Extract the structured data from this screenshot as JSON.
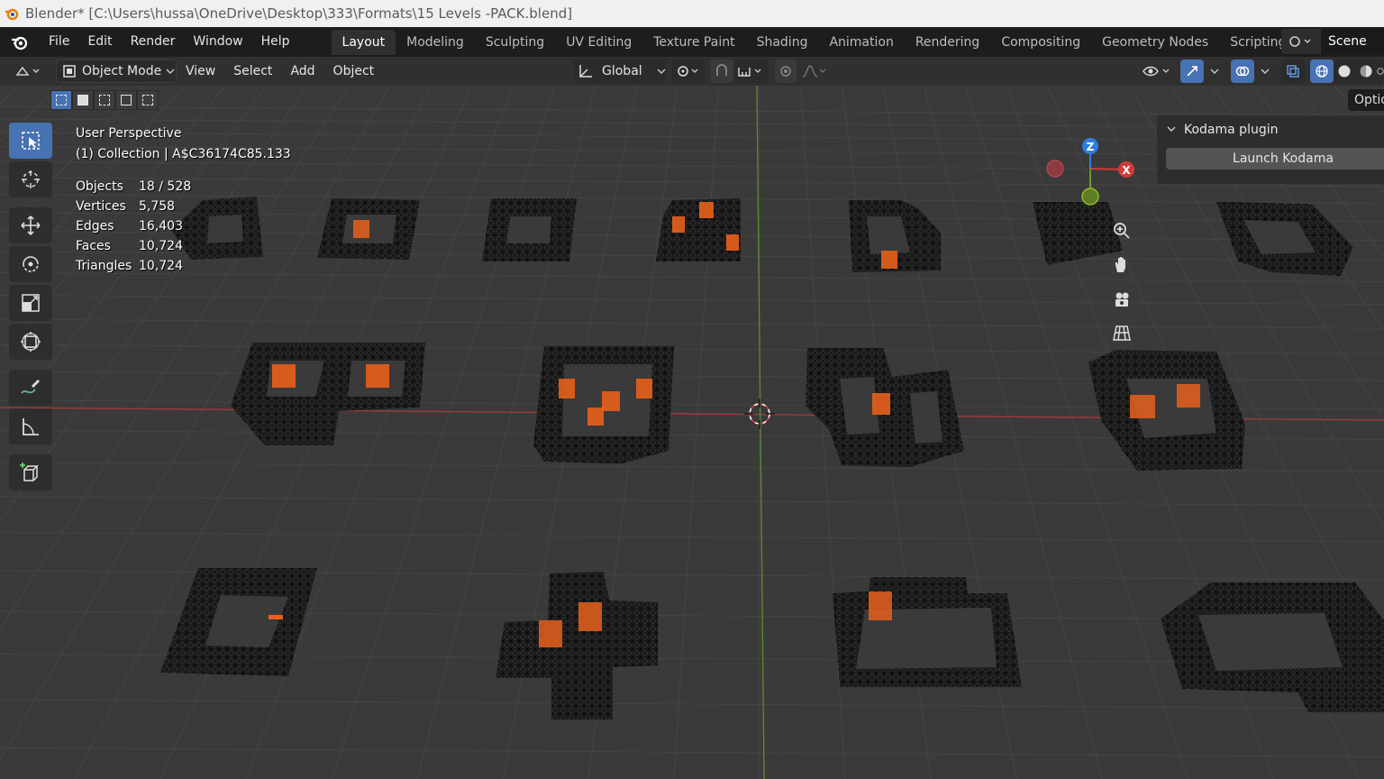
{
  "window": {
    "title": "Blender* [C:\\Users\\hussa\\OneDrive\\Desktop\\333\\Formats\\15 Levels -PACK.blend]"
  },
  "menubar": {
    "items": [
      "File",
      "Edit",
      "Render",
      "Window",
      "Help"
    ]
  },
  "workspaces": {
    "tabs": [
      "Layout",
      "Modeling",
      "Sculpting",
      "UV Editing",
      "Texture Paint",
      "Shading",
      "Animation",
      "Rendering",
      "Compositing",
      "Geometry Nodes",
      "Scripting"
    ],
    "active": "Layout",
    "add_label": "+"
  },
  "scene": {
    "name": "Scene"
  },
  "header": {
    "mode": "Object Mode",
    "menus": [
      "View",
      "Select",
      "Add",
      "Object"
    ],
    "orientation": "Global"
  },
  "viewport": {
    "perspective": "User Perspective",
    "collection": "(1) Collection | A$C36174C85.133",
    "options_label": "Options"
  },
  "stats": {
    "rows": [
      {
        "label": "Objects",
        "value": "18 / 528"
      },
      {
        "label": "Vertices",
        "value": "5,758"
      },
      {
        "label": "Edges",
        "value": "16,403"
      },
      {
        "label": "Faces",
        "value": "10,724"
      },
      {
        "label": "Triangles",
        "value": "10,724"
      }
    ]
  },
  "gizmo": {
    "z": "Z",
    "x": "X"
  },
  "npanel": {
    "section": "Kodama plugin",
    "button": "Launch Kodama"
  },
  "colors": {
    "accent": "#4772b3",
    "selected_orange": "#e8601c",
    "axis_red": "#c0393b",
    "axis_green": "#6a9a2a"
  }
}
